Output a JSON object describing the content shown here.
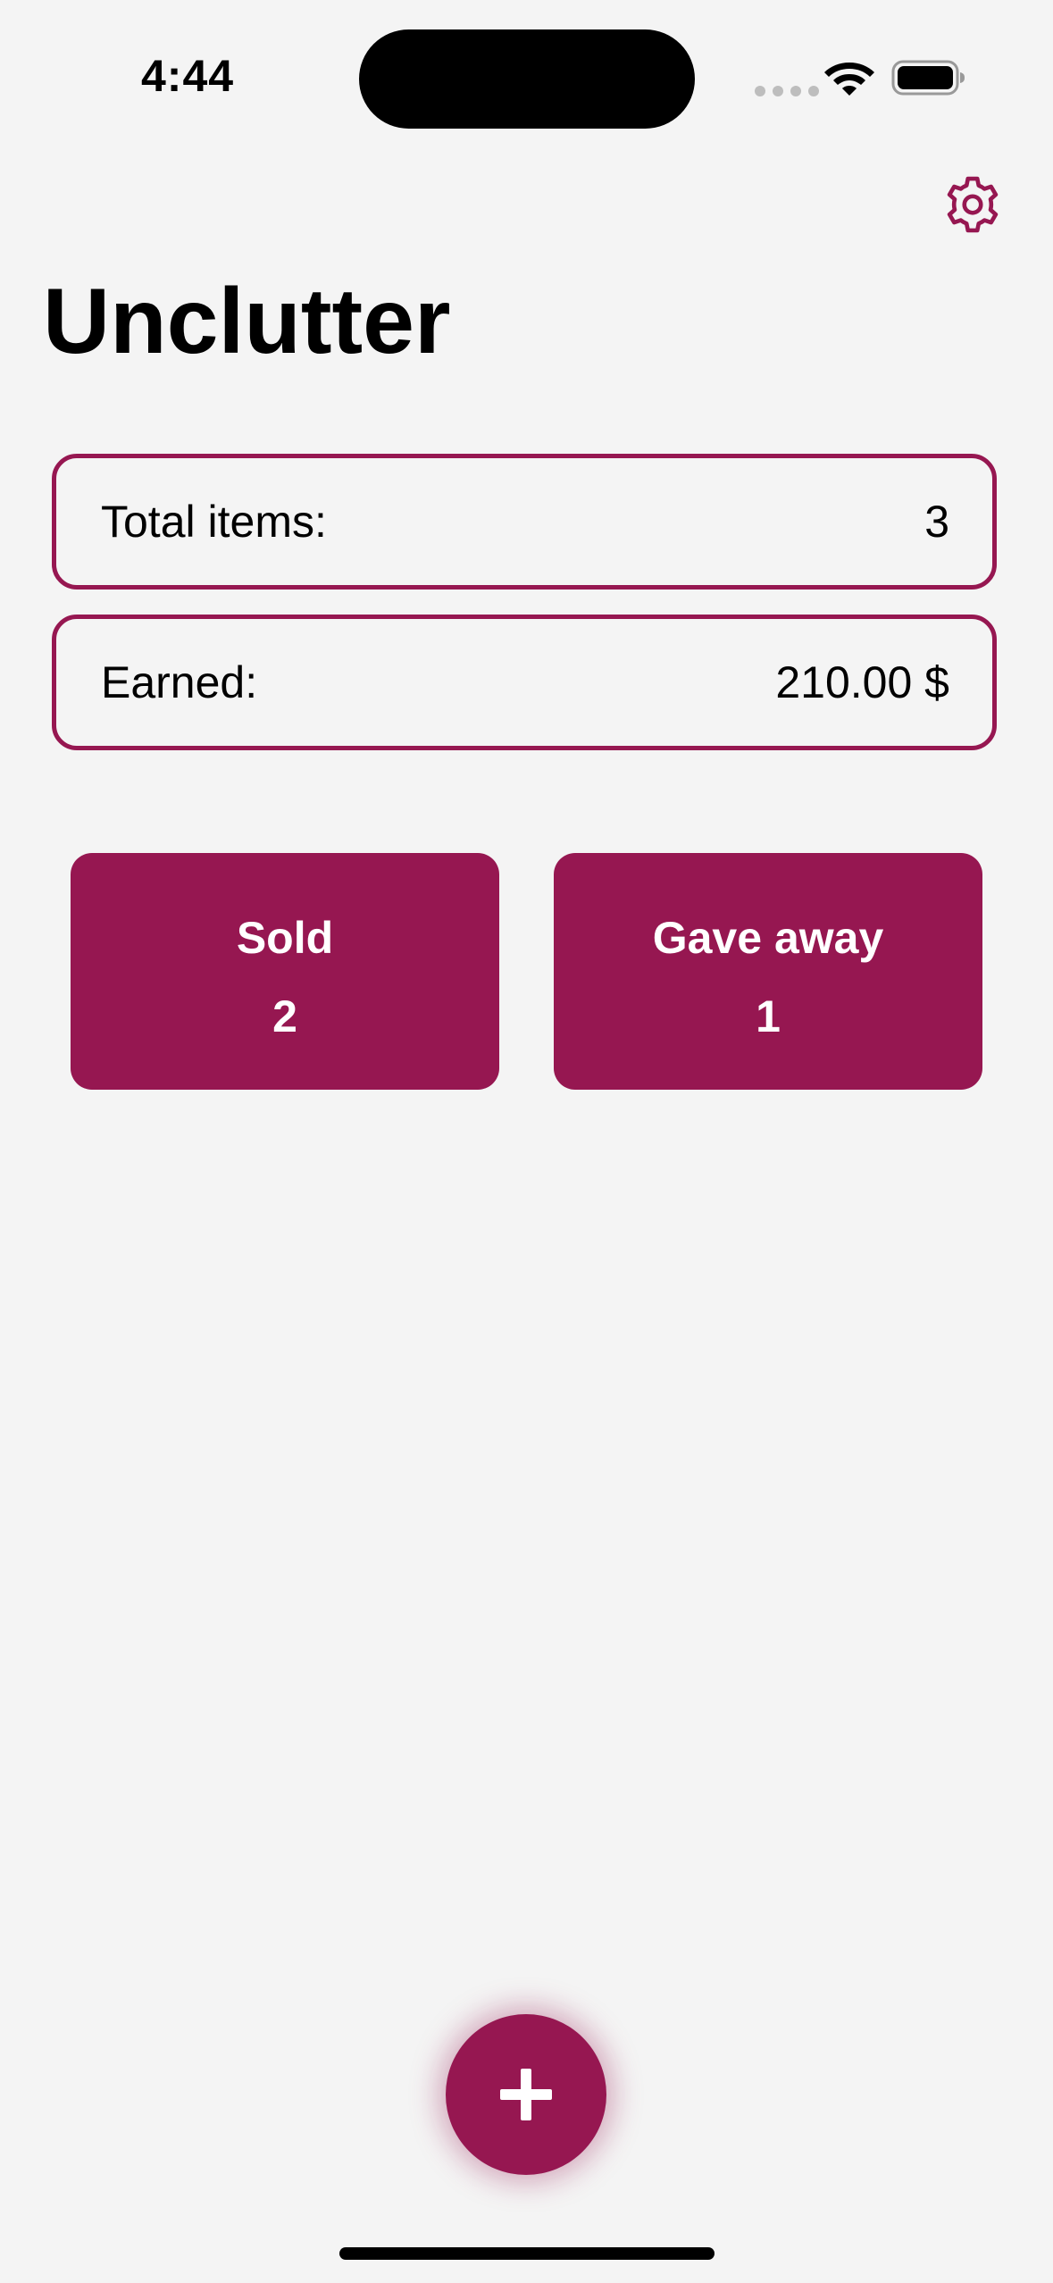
{
  "status_bar": {
    "time": "4:44"
  },
  "header": {
    "title": "Unclutter",
    "settings_icon": "gear-icon"
  },
  "stats": {
    "total_items_label": "Total items:",
    "total_items_value": "3",
    "earned_label": "Earned:",
    "earned_value": "210.00 $"
  },
  "tiles": [
    {
      "label": "Sold",
      "count": "2"
    },
    {
      "label": "Gave away",
      "count": "1"
    }
  ],
  "fab": {
    "icon": "plus-icon"
  },
  "colors": {
    "accent": "#961751",
    "background": "#f4f4f4"
  }
}
